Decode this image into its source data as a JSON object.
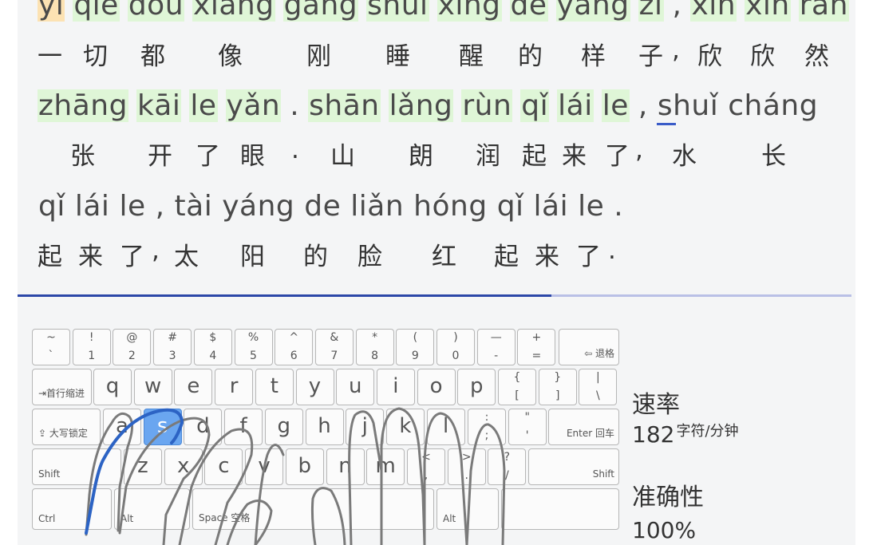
{
  "text": {
    "line1_pinyin": [
      {
        "w": "yi",
        "s": "err"
      },
      {
        "w": "qie",
        "s": "ok"
      },
      {
        "w": "dou",
        "s": "ok"
      },
      {
        "w": "xiang",
        "s": "ok"
      },
      {
        "w": "gang",
        "s": "ok"
      },
      {
        "w": "shui",
        "s": "ok"
      },
      {
        "w": "xing",
        "s": "ok"
      },
      {
        "w": "de",
        "s": "ok"
      },
      {
        "w": "yang",
        "s": "ok"
      },
      {
        "w": "zi",
        "s": "ok"
      },
      {
        "w": ",",
        "s": "sep"
      },
      {
        "w": "xin",
        "s": "ok"
      },
      {
        "w": "xin",
        "s": "ok"
      },
      {
        "w": "ran",
        "s": "ok"
      }
    ],
    "line1_hanzi": [
      "一",
      "切",
      "都",
      "像",
      "刚",
      "睡",
      "醒",
      "的",
      "样",
      "子",
      ",",
      "欣",
      "欣",
      "然"
    ],
    "line2_pinyin": [
      {
        "w": "zhāng",
        "s": "ok"
      },
      {
        "w": "kāi",
        "s": "ok"
      },
      {
        "w": "le",
        "s": "ok"
      },
      {
        "w": "yǎn",
        "s": "ok"
      },
      {
        "w": ".",
        "s": "sep"
      },
      {
        "w": "shān",
        "s": "ok"
      },
      {
        "w": "lǎng",
        "s": "ok"
      },
      {
        "w": "rùn",
        "s": "ok"
      },
      {
        "w": "qǐ",
        "s": "ok"
      },
      {
        "w": "lái",
        "s": "ok"
      },
      {
        "w": "le",
        "s": "ok"
      },
      {
        "w": ",",
        "s": "sep"
      },
      {
        "w": "shuǐ",
        "s": "cur"
      },
      {
        "w": "cháng",
        "s": "pending"
      }
    ],
    "line2_hanzi": [
      "张",
      "开",
      "了",
      "眼",
      ".",
      "山",
      "朗",
      "润",
      "起",
      "来",
      "了",
      ",",
      "水",
      "长"
    ],
    "line3_pinyin": [
      {
        "w": "qǐ",
        "s": "pending"
      },
      {
        "w": "lái",
        "s": "pending"
      },
      {
        "w": "le",
        "s": "pending"
      },
      {
        "w": ",",
        "s": "sep"
      },
      {
        "w": "tài",
        "s": "pending"
      },
      {
        "w": "yáng",
        "s": "pending"
      },
      {
        "w": "de",
        "s": "pending"
      },
      {
        "w": "liǎn",
        "s": "pending"
      },
      {
        "w": "hóng",
        "s": "pending"
      },
      {
        "w": "qǐ",
        "s": "pending"
      },
      {
        "w": "lái",
        "s": "pending"
      },
      {
        "w": "le",
        "s": "pending"
      },
      {
        "w": ".",
        "s": "sep"
      }
    ],
    "line3_hanzi": [
      "起",
      "来",
      "了",
      ",",
      "太",
      "阳",
      "的",
      "脸",
      "红",
      "起",
      "来",
      "了",
      "."
    ]
  },
  "progress": {
    "fraction": 0.64
  },
  "keyboard": {
    "row1": [
      {
        "top": "~",
        "bot": "`"
      },
      {
        "top": "!",
        "bot": "1"
      },
      {
        "top": "@",
        "bot": "2"
      },
      {
        "top": "#",
        "bot": "3"
      },
      {
        "top": "$",
        "bot": "4"
      },
      {
        "top": "%",
        "bot": "5"
      },
      {
        "top": "^",
        "bot": "6"
      },
      {
        "top": "&",
        "bot": "7"
      },
      {
        "top": "*",
        "bot": "8"
      },
      {
        "top": "(",
        "bot": "9"
      },
      {
        "top": ")",
        "bot": "0"
      },
      {
        "top": "—",
        "bot": "-"
      },
      {
        "top": "+",
        "bot": "="
      }
    ],
    "backspace": "⇦ 退格",
    "tab": "⇥首行缩进",
    "row2": [
      "q",
      "w",
      "e",
      "r",
      "t",
      "y",
      "u",
      "i",
      "o",
      "p"
    ],
    "row2_sym": [
      {
        "top": "{",
        "bot": "["
      },
      {
        "top": "}",
        "bot": "]"
      },
      {
        "top": "|",
        "bot": "\\"
      }
    ],
    "caps": "⇪ 大写锁定",
    "row3": [
      "a",
      "s",
      "d",
      "f",
      "g",
      "h",
      "j",
      "k",
      "l"
    ],
    "row3_sym": [
      {
        "top": ":",
        "bot": ";"
      },
      {
        "top": "\"",
        "bot": "'"
      }
    ],
    "enter": "Enter 回车",
    "shift_left": "Shift",
    "row4": [
      "z",
      "x",
      "c",
      "v",
      "b",
      "n",
      "m"
    ],
    "row4_sym": [
      {
        "top": "<",
        "bot": ","
      },
      {
        "top": ">",
        "bot": "."
      },
      {
        "top": "?",
        "bot": "/"
      }
    ],
    "shift_right": "Shift",
    "ctrl": "Ctrl",
    "alt_left": "Alt",
    "space": "Space 空格",
    "alt_right": "Alt",
    "highlight_key": "s",
    "highlight_color": "#6aa6f0"
  },
  "stats": {
    "speed_label": "速率",
    "speed_value": "182",
    "speed_unit": "字符/分钟",
    "accuracy_label": "准确性",
    "accuracy_value": "100%"
  }
}
